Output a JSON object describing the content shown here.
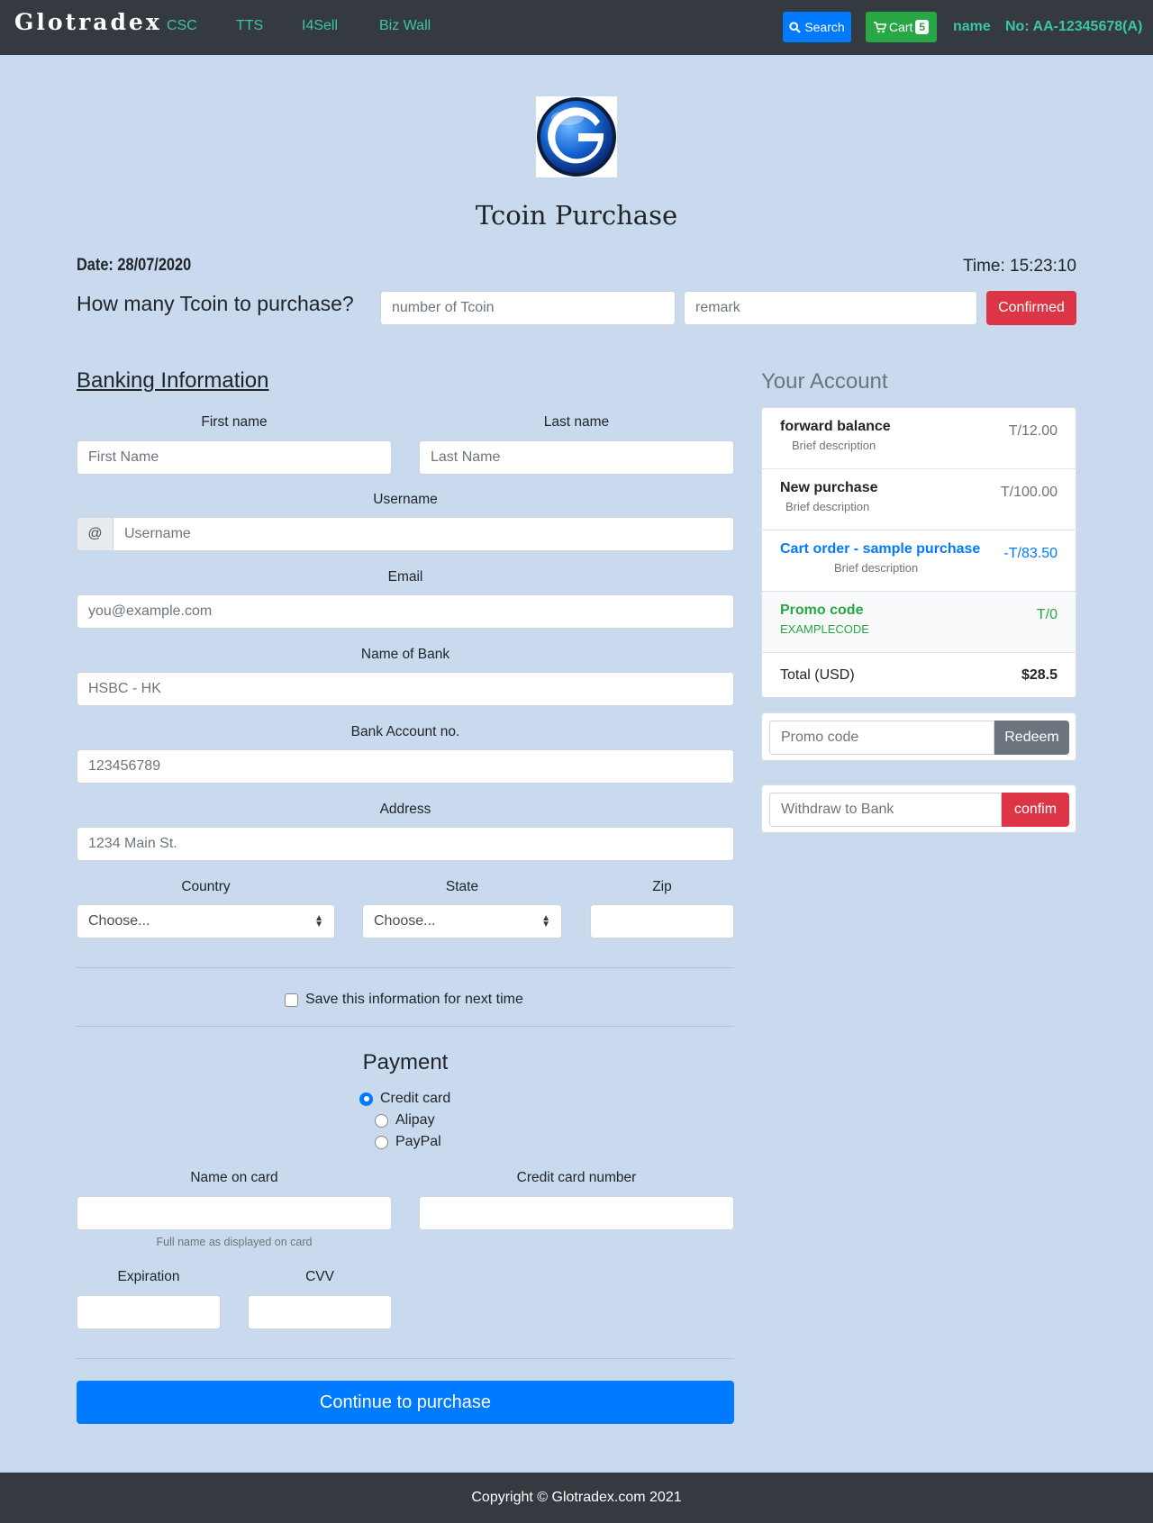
{
  "nav": {
    "brand": "Glotradex",
    "links": [
      "CSC",
      "TTS",
      "I4Sell",
      "Biz Wall"
    ],
    "search_label": "Search",
    "cart_label": "Cart",
    "cart_count": "5",
    "user_name": "name",
    "account_no": "No: AA-12345678(A)"
  },
  "header": {
    "title": "Tcoin Purchase",
    "date": "Date: 28/07/2020",
    "time": "Time: 15:23:10"
  },
  "purchase": {
    "question": "How many Tcoin to purchase?",
    "tcoin_placeholder": "number of Tcoin",
    "remark_placeholder": "remark",
    "confirm_label": "Confirmed"
  },
  "banking": {
    "heading": "Banking Information",
    "first_name_label": "First name",
    "first_name_placeholder": "First Name",
    "last_name_label": "Last name",
    "last_name_placeholder": "Last Name",
    "username_label": "Username",
    "username_addon": "@",
    "username_placeholder": "Username",
    "email_label": "Email",
    "email_placeholder": "you@example.com",
    "bank_label": "Name of Bank",
    "bank_placeholder": "HSBC - HK",
    "account_label": "Bank Account no.",
    "account_placeholder": "123456789",
    "address_label": "Address",
    "address_placeholder": "1234 Main St.",
    "country_label": "Country",
    "country_value": "Choose...",
    "state_label": "State",
    "state_value": "Choose...",
    "zip_label": "Zip",
    "save_info_label": "Save this information for next time"
  },
  "payment": {
    "heading": "Payment",
    "methods": [
      "Credit card",
      "Alipay",
      "PayPal"
    ],
    "selected_method": "Credit card",
    "card_name_label": "Name on card",
    "card_name_help": "Full name as displayed on card",
    "card_number_label": "Credit card number",
    "expiration_label": "Expiration",
    "cvv_label": "CVV",
    "continue_label": "Continue to purchase"
  },
  "account": {
    "heading": "Your Account",
    "items": [
      {
        "title": "forward balance",
        "desc": "Brief description",
        "amount": "T/12.00"
      },
      {
        "title": "New purchase",
        "desc": "Brief description",
        "amount": "T/100.00"
      },
      {
        "title": "Cart order - sample purchase",
        "desc": "Brief description",
        "amount": "-T/83.50"
      },
      {
        "title": "Promo code",
        "desc": "EXAMPLECODE",
        "amount": "T/0"
      }
    ],
    "total_label": "Total (USD)",
    "total_value": "$28.5",
    "promo_placeholder": "Promo code",
    "redeem_label": "Redeem",
    "withdraw_placeholder": "Withdraw to Bank",
    "withdraw_confirm_label": "confim"
  },
  "footer": {
    "copyright": "Copyright © Glotradex.com 2021"
  },
  "colors": {
    "background": "#c9d9ee",
    "navbar": "#343a40",
    "nav_link": "#3cc4a8",
    "primary": "#007bff",
    "success": "#28a745",
    "danger": "#dc3545",
    "secondary": "#6c757d"
  }
}
